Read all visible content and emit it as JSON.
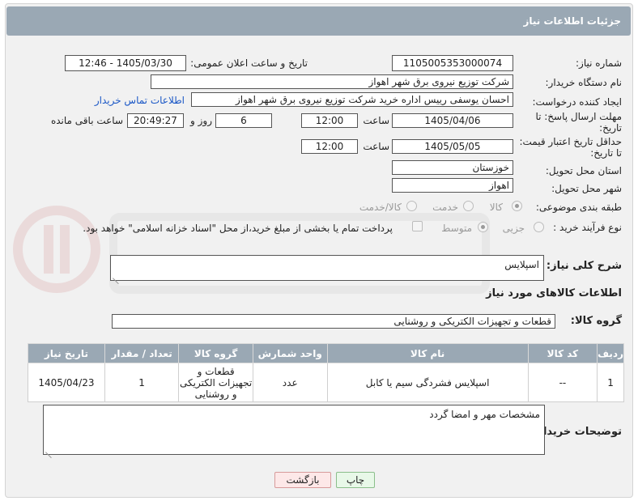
{
  "header": {
    "title": "جزئیات اطلاعات نیاز"
  },
  "form": {
    "need_number_label": "شماره نیاز:",
    "need_number": "1105005353000074",
    "announce_datetime_label": "تاریخ و ساعت اعلان عمومی:",
    "announce_datetime": "1405/03/30 - 12:46",
    "buyer_org_label": "نام دستگاه خریدار:",
    "buyer_org": "شرکت توزیع نیروی برق شهر اهواز",
    "requester_label": "ایجاد کننده درخواست:",
    "requester": "احسان یوسفی رییس اداره خرید شرکت توزیع نیروی برق شهر اهواز",
    "buyer_contact_link": "اطلاعات تماس خریدار",
    "reply_deadline_label_1": "مهلت ارسال پاسخ: تا",
    "reply_deadline_label_2": "تاریخ:",
    "reply_date": "1405/04/06",
    "time_label": "ساعت",
    "reply_time": "12:00",
    "days_value": "6",
    "days_and_label": "روز و",
    "remaining_time": "20:49:27",
    "remaining_label": "ساعت باقی مانده",
    "price_validity_label_1": "حداقل تاریخ اعتبار قیمت:",
    "price_validity_label_2": "تا تاریخ:",
    "price_date": "1405/05/05",
    "price_time": "12:00",
    "province_label": "استان محل تحویل:",
    "province": "خوزستان",
    "city_label": "شهر محل تحویل:",
    "city": "اهواز",
    "category_label": "طبقه بندی موضوعی:",
    "category_options": [
      "کالا",
      "خدمت",
      "کالا/خدمت"
    ],
    "category_selected": "کالا",
    "purchase_type_label": "نوع فرآیند خرید :",
    "purchase_options": [
      "جزیی",
      "متوسط"
    ],
    "purchase_selected": "متوسط",
    "payment_note": "پرداخت تمام یا بخشی از مبلغ خرید،از محل \"اسناد خزانه اسلامی\" خواهد بود."
  },
  "description": {
    "label": "شرح کلی نیاز:",
    "value": "اسپلایس"
  },
  "goods_section": {
    "title": "اطلاعات کالاهای مورد نیاز",
    "group_label": "گروه کالا:",
    "group_value": "قطعات و تجهیزات الکتریکی و روشنایی"
  },
  "table": {
    "headers": [
      "ردیف",
      "کد کالا",
      "نام کالا",
      "واحد شمارش",
      "گروه کالا",
      "تعداد / مقدار",
      "تاریخ نیاز"
    ],
    "rows": [
      [
        "1",
        "--",
        "اسپلایس فشردگی سیم یا کابل",
        "عدد",
        "قطعات و تجهیزات الکتریکی و روشنایی",
        "1",
        "1405/04/23"
      ]
    ]
  },
  "buyer_notes": {
    "label": "توضیحات خریدار:",
    "value": "مشخصات مهر و امضا گردد"
  },
  "buttons": {
    "print": "چاپ",
    "back": "بازگشت"
  },
  "colors": {
    "header": "#9aa8b4",
    "link": "#1a57c6",
    "print_bg": "#e8f8e8",
    "back_bg": "#fde8e8"
  }
}
